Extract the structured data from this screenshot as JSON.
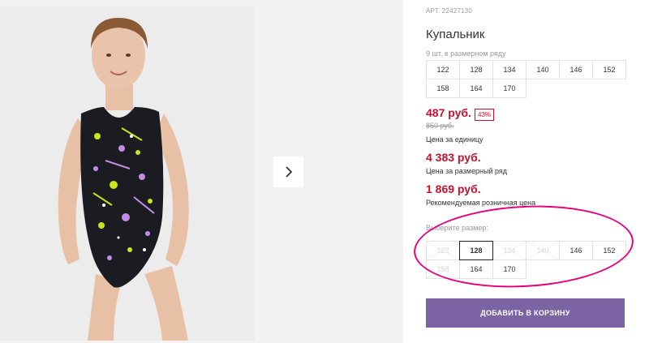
{
  "product": {
    "article_label": "АРТ.",
    "article": "22427130",
    "title": "Купальник",
    "pack_info": "9 шт. в размерном ряду"
  },
  "size_row": [
    "122",
    "128",
    "134",
    "140",
    "146",
    "152",
    "158",
    "164",
    "170"
  ],
  "prices": {
    "unit_price": "487 руб.",
    "discount": "43%",
    "old_price": "850 руб.",
    "unit_price_note": "Цена за единицу",
    "row_price": "4 383 руб.",
    "row_price_note": "Цена за размерный ряд",
    "retail_price": "1 869 руб.",
    "retail_price_note": "Рекомендуемая розничная цена"
  },
  "size_picker": {
    "label": "Выберите размер:",
    "sizes": [
      {
        "label": "122",
        "state": "disabled"
      },
      {
        "label": "128",
        "state": "selected"
      },
      {
        "label": "134",
        "state": "disabled"
      },
      {
        "label": "140",
        "state": "disabled"
      },
      {
        "label": "146",
        "state": "available"
      },
      {
        "label": "152",
        "state": "available"
      },
      {
        "label": "158",
        "state": "disabled"
      },
      {
        "label": "164",
        "state": "available"
      },
      {
        "label": "170",
        "state": "available"
      }
    ]
  },
  "cart_button": "ДОБАВИТЬ В КОРЗИНУ",
  "gallery": {
    "next_icon": "chevron-right-icon"
  },
  "colors": {
    "price_red": "#c8102e",
    "cart_purple": "#7b63a4",
    "highlight_magenta": "#e6007e",
    "swimsuit_yellow": "#c8e619",
    "swimsuit_lilac": "#c58ce6"
  }
}
